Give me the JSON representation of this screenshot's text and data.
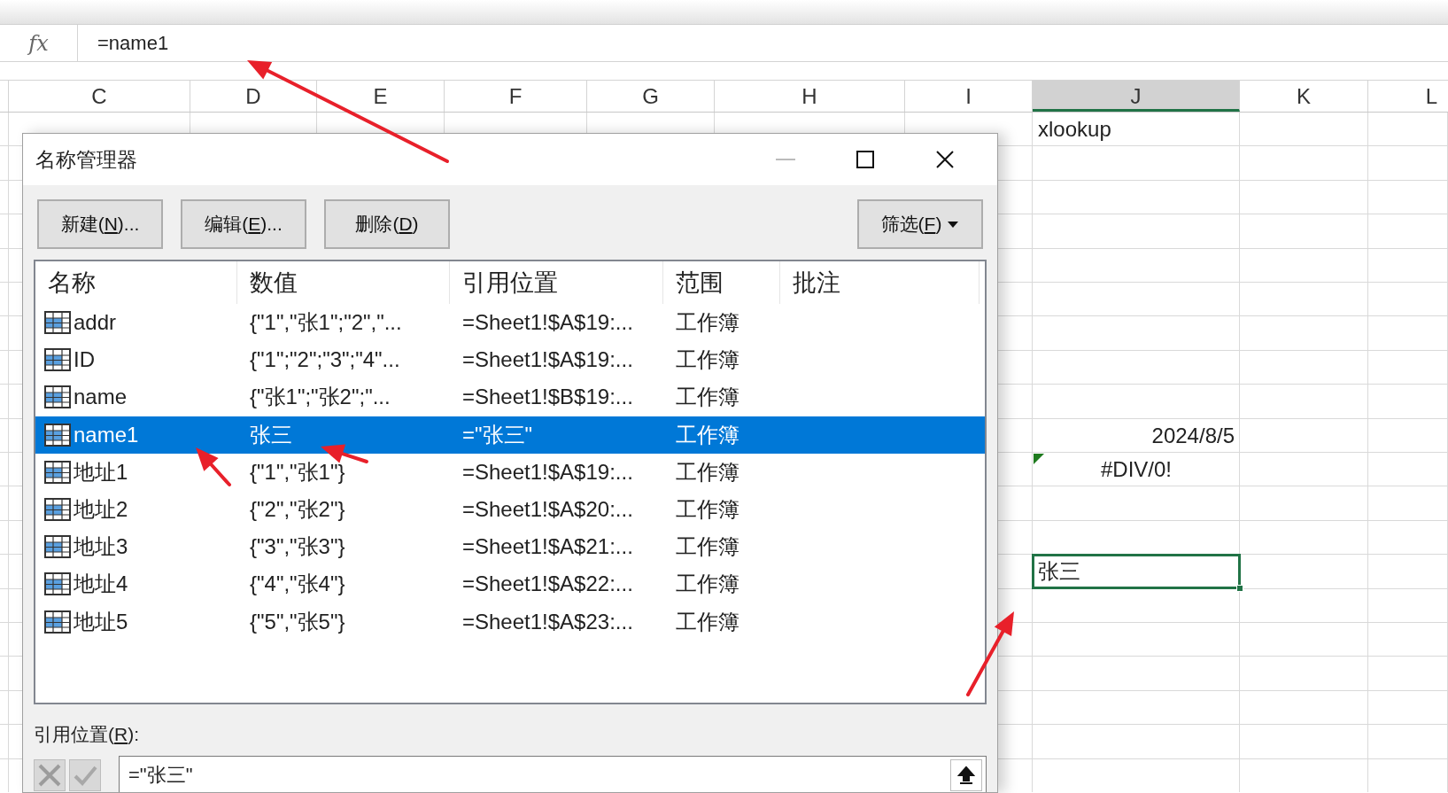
{
  "formula_bar": {
    "function_label": "fx",
    "formula": "=name1"
  },
  "sheet": {
    "columns": [
      {
        "label": "C",
        "selected": false
      },
      {
        "label": "D",
        "selected": false
      },
      {
        "label": "E",
        "selected": false
      },
      {
        "label": "F",
        "selected": false
      },
      {
        "label": "G",
        "selected": false
      },
      {
        "label": "H",
        "selected": false
      },
      {
        "label": "I",
        "selected": false
      },
      {
        "label": "J",
        "selected": true
      },
      {
        "label": "K",
        "selected": false
      },
      {
        "label": "L",
        "selected": false
      }
    ],
    "cells": [
      {
        "kind": "text",
        "text": "xlookup",
        "active": false
      },
      {
        "kind": "date",
        "text": "2024/8/5",
        "active": false
      },
      {
        "kind": "error",
        "text": "#DIV/0!",
        "active": false
      },
      {
        "kind": "text",
        "text": "张三",
        "active": true
      }
    ]
  },
  "dialog": {
    "title": "名称管理器",
    "buttons": [
      {
        "before": "新建(",
        "key": "N",
        "after": ")...",
        "kind": "plain"
      },
      {
        "before": "编辑(",
        "key": "E",
        "after": ")...",
        "kind": "plain"
      },
      {
        "before": "删除(",
        "key": "D",
        "after": ")",
        "kind": "plain"
      },
      {
        "before": "筛选(",
        "key": "F",
        "after": ")",
        "kind": "dropdown"
      }
    ],
    "columns": [
      "名称",
      "数值",
      "引用位置",
      "范围",
      "批注"
    ],
    "rows": [
      {
        "name": "addr",
        "value": "{\"1\",\"张1\";\"2\",\"...",
        "refers_to": "=Sheet1!$A$19:...",
        "scope": "工作簿",
        "selected": false
      },
      {
        "name": "ID",
        "value": "{\"1\";\"2\";\"3\";\"4\"...",
        "refers_to": "=Sheet1!$A$19:...",
        "scope": "工作簿",
        "selected": false
      },
      {
        "name": "name",
        "value": "{\"张1\";\"张2\";\"...",
        "refers_to": "=Sheet1!$B$19:...",
        "scope": "工作簿",
        "selected": false
      },
      {
        "name": "name1",
        "value": "张三",
        "refers_to": "=\"张三\"",
        "scope": "工作簿",
        "selected": true
      },
      {
        "name": "地址1",
        "value": "{\"1\",\"张1\"}",
        "refers_to": "=Sheet1!$A$19:...",
        "scope": "工作簿",
        "selected": false
      },
      {
        "name": "地址2",
        "value": "{\"2\",\"张2\"}",
        "refers_to": "=Sheet1!$A$20:...",
        "scope": "工作簿",
        "selected": false
      },
      {
        "name": "地址3",
        "value": "{\"3\",\"张3\"}",
        "refers_to": "=Sheet1!$A$21:...",
        "scope": "工作簿",
        "selected": false
      },
      {
        "name": "地址4",
        "value": "{\"4\",\"张4\"}",
        "refers_to": "=Sheet1!$A$22:...",
        "scope": "工作簿",
        "selected": false
      },
      {
        "name": "地址5",
        "value": "{\"5\",\"张5\"}",
        "refers_to": "=Sheet1!$A$23:...",
        "scope": "工作簿",
        "selected": false
      }
    ],
    "refers_to_label": {
      "before": "引用位置(",
      "key": "R",
      "after": "):"
    },
    "refers_to_value": "=\"张三\""
  }
}
